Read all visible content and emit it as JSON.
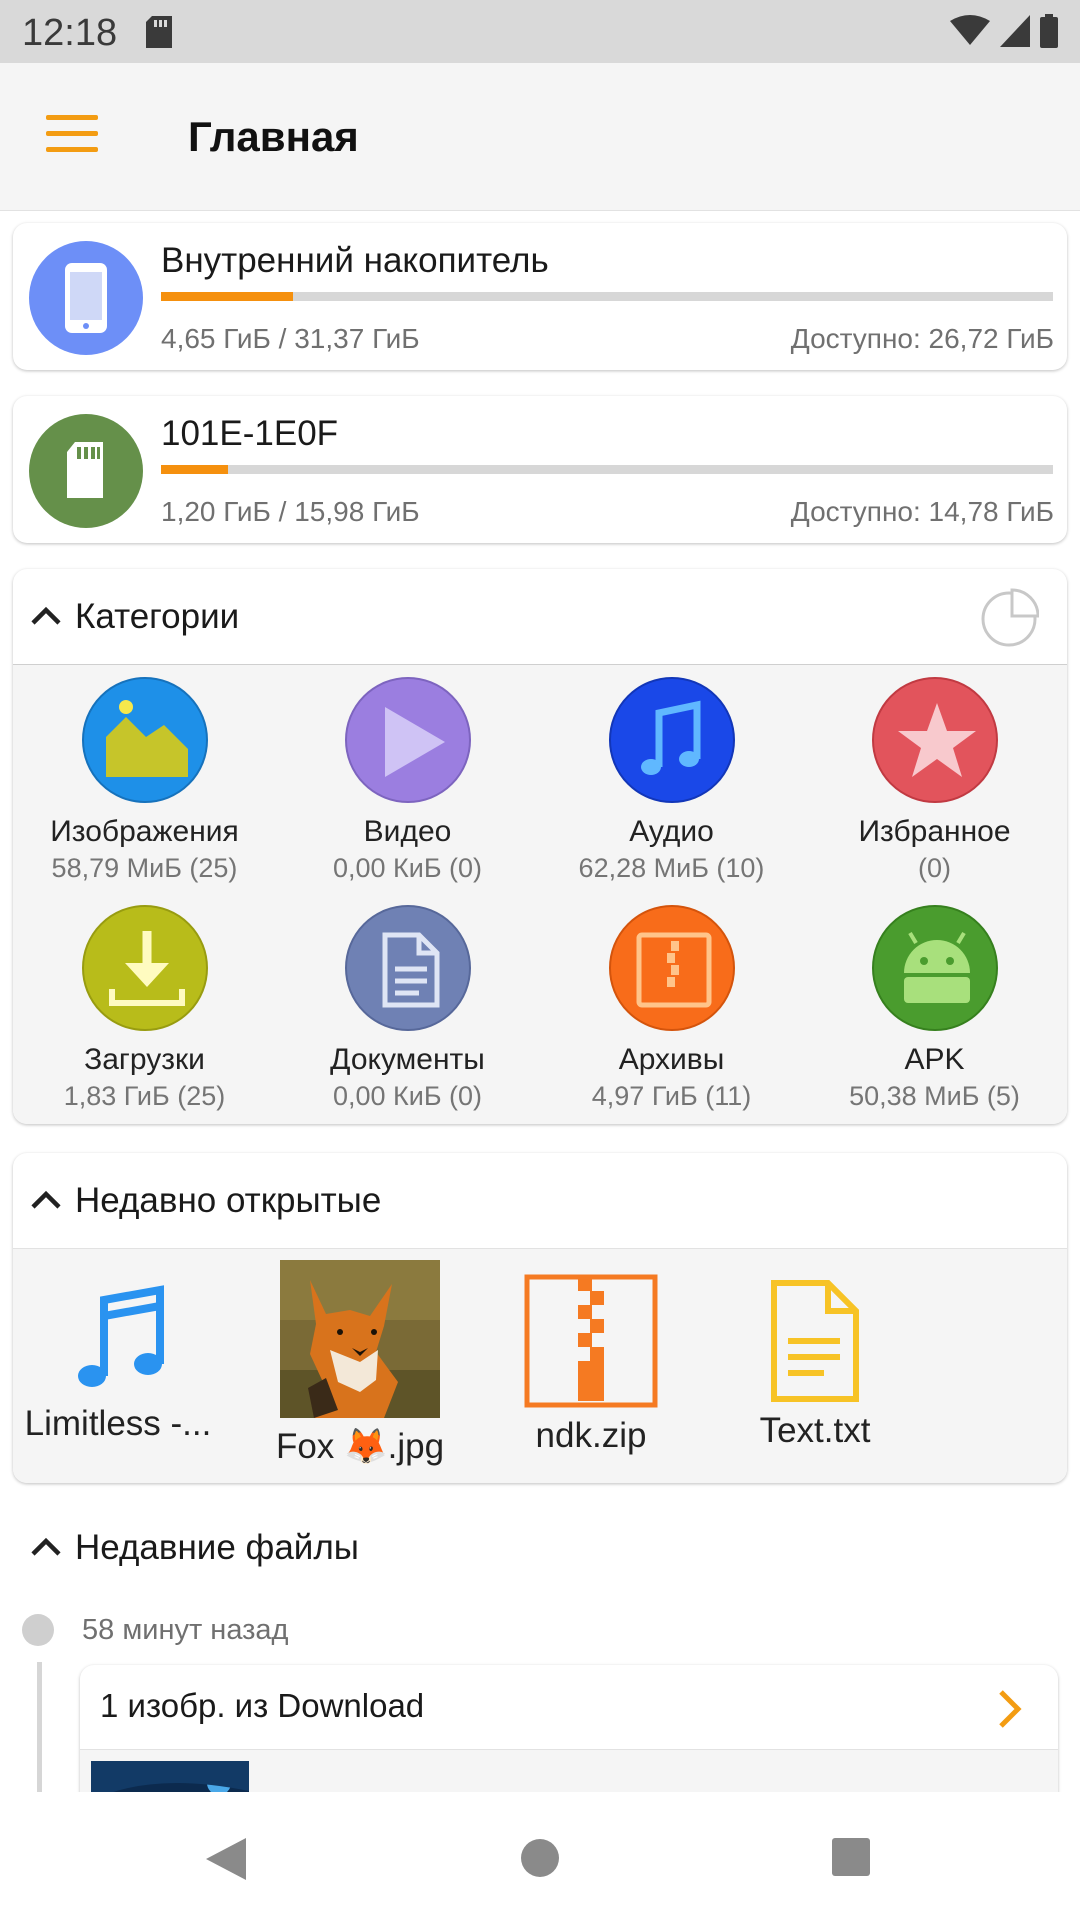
{
  "status": {
    "time": "12:18"
  },
  "appbar": {
    "title": "Главная"
  },
  "storage": [
    {
      "name": "Внутренний накопитель",
      "used": "4,65 ГиБ / 31,37 ГиБ",
      "available": "Доступно: 26,72 ГиБ",
      "fraction": 0.148,
      "color": "#6d8ff7",
      "icon": "phone-icon"
    },
    {
      "name": "101E-1E0F",
      "used": "1,20 ГиБ / 15,98 ГиБ",
      "available": "Доступно: 14,78 ГиБ",
      "fraction": 0.075,
      "color": "#65904a",
      "icon": "sd-card-icon"
    }
  ],
  "categories": {
    "header": "Категории",
    "items": [
      {
        "name": "Изображения",
        "size": "58,79 МиБ (25)",
        "color": "#1e90e8",
        "icon": "image-icon"
      },
      {
        "name": "Видео",
        "size": "0,00 КиБ (0)",
        "color": "#9b7ee0",
        "icon": "play-icon"
      },
      {
        "name": "Аудио",
        "size": "62,28 МиБ (10)",
        "color": "#1a48e8",
        "icon": "music-note-icon"
      },
      {
        "name": "Избранное",
        "size": "(0)",
        "color": "#e2545c",
        "icon": "star-icon"
      },
      {
        "name": "Загрузки",
        "size": "1,83 ГиБ (25)",
        "color": "#b8bc1a",
        "icon": "download-icon"
      },
      {
        "name": "Документы",
        "size": "0,00 КиБ (0)",
        "color": "#6f81b4",
        "icon": "document-icon"
      },
      {
        "name": "Архивы",
        "size": "4,97 ГиБ (11)",
        "color": "#f86c1a",
        "icon": "archive-icon"
      },
      {
        "name": "APK",
        "size": "50,38 МиБ (5)",
        "color": "#4a9c2e",
        "icon": "android-icon"
      }
    ]
  },
  "recent_opened": {
    "header": "Недавно открытые",
    "items": [
      {
        "label": "Limitless -...",
        "icon": "music-note-icon"
      },
      {
        "label": "Fox 🦊.jpg",
        "icon": "fox-thumbnail"
      },
      {
        "label": "ndk.zip",
        "icon": "zip-icon"
      },
      {
        "label": "Text.txt",
        "icon": "text-file-icon"
      }
    ]
  },
  "recent_files": {
    "header": "Недавние файлы",
    "time": "58 минут назад",
    "group": "1 изобр. из Download"
  },
  "colors": {
    "accent": "#f39c12"
  }
}
